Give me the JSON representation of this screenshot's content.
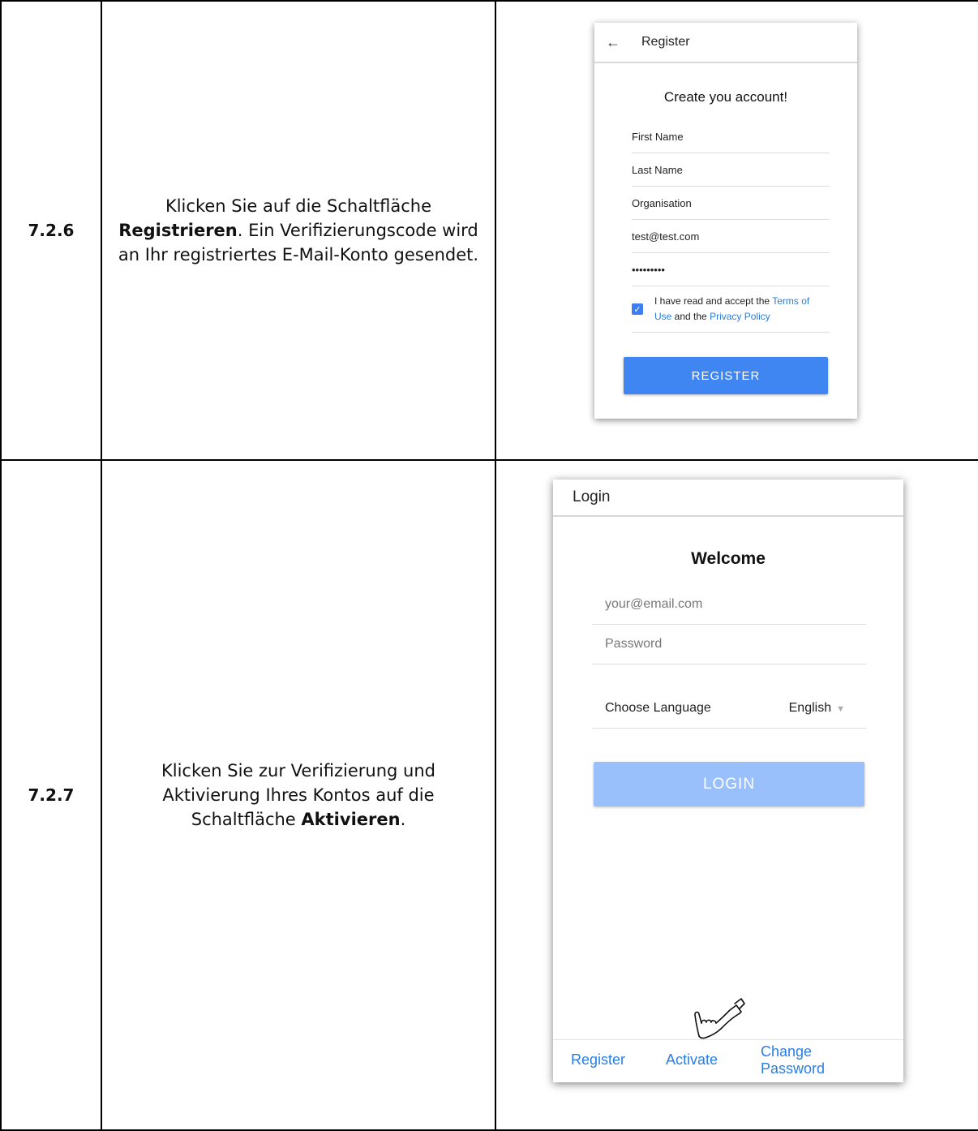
{
  "rows": [
    {
      "step": "7.2.6",
      "desc_before": "Klicken Sie auf die Schaltfläche",
      "desc_bold": "Registrieren",
      "desc_after": ". Ein Verifizierungscode wird an Ihr registriertes E-Mail-Konto gesendet."
    },
    {
      "step": "7.2.7",
      "desc_before": "Klicken Sie zur Verifizierung und Aktivierung Ihres Kontos auf die Schaltfläche",
      "desc_bold": "Aktivieren",
      "desc_after": "."
    }
  ],
  "register_screen": {
    "back_icon": "arrow-left-icon",
    "title": "Register",
    "heading": "Create you account!",
    "fields": [
      "First Name",
      "Last Name",
      "Organisation",
      "test@test.com",
      "•••••••••"
    ],
    "terms_prefix": "I have read and accept the ",
    "terms_link": "Terms of Use",
    "terms_mid": " and the ",
    "privacy_link": "Privacy Policy",
    "terms_checked": true,
    "button": "REGISTER",
    "accent": "#3f86f2"
  },
  "login_screen": {
    "title": "Login",
    "heading": "Welcome",
    "email_placeholder": "your@email.com",
    "password_placeholder": "Password",
    "language_label": "Choose Language",
    "language_value": "English",
    "button": "LOGIN",
    "button_color": "#9ac0fb",
    "nav_register": "Register",
    "nav_activate": "Activate",
    "nav_change_line1": "Change",
    "nav_change_line2": "Password",
    "pointer_icon": "pointing-hand-icon"
  }
}
